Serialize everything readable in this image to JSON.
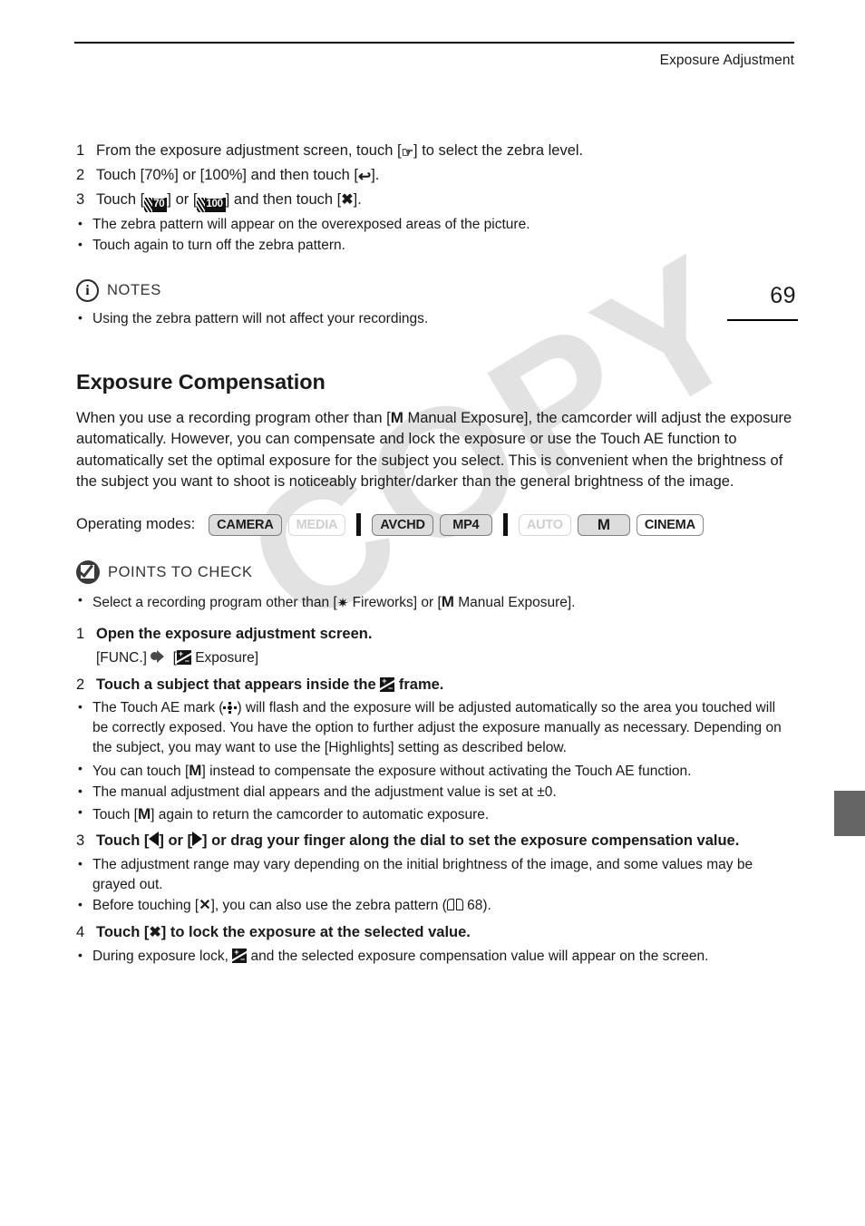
{
  "header": {
    "running_head": "Exposure Adjustment",
    "page_number": "69"
  },
  "zebra_steps": {
    "step1": {
      "num": "1",
      "pre": "From the exposure adjustment screen, touch [",
      "post": "] to select the zebra level.",
      "icon": "zebra-level-icon"
    },
    "step2": {
      "num": "2",
      "pre": "Touch [70%] or [100%] and then touch [",
      "post": "].",
      "icon": "return-icon"
    },
    "step3": {
      "num": "3",
      "pre": "Touch [",
      "mid": "] or [",
      "post": "] and then touch [",
      "tail": "].",
      "zebra70": "70",
      "zebra100": "100"
    },
    "bullets": [
      "The zebra pattern will appear on the overexposed areas of the picture.",
      "Touch again to turn off the zebra pattern."
    ]
  },
  "notes": {
    "label": "NOTES",
    "icon": "info-icon",
    "bullets": [
      "Using the zebra pattern will not affect your recordings."
    ]
  },
  "section": {
    "title": "Exposure Compensation",
    "intro_a": "When you use a recording program other than [",
    "intro_m": "M",
    "intro_b": " Manual Exposure], the camcorder will adjust the exposure automatically. However, you can compensate and lock the exposure or use the Touch AE function to automatically set the optimal exposure for the subject you select. This is convenient when the brightness of the subject you want to shoot is noticeably brighter/darker than the general brightness of the image."
  },
  "operating_modes": {
    "label": "Operating modes:",
    "badges": [
      {
        "label": "CAMERA",
        "state": "active"
      },
      {
        "label": "MEDIA",
        "state": "disabled"
      },
      {
        "label": "AVCHD",
        "state": "active"
      },
      {
        "label": "MP4",
        "state": "active"
      },
      {
        "label": "AUTO",
        "state": "disabled"
      },
      {
        "label": "M",
        "state": "active"
      },
      {
        "label": "CINEMA",
        "state": "outline"
      }
    ]
  },
  "points_to_check": {
    "label": "POINTS TO CHECK",
    "icon": "check-circle-icon",
    "bullet_a": "Select a recording program other than [",
    "bullet_fireworks": " Fireworks] or [",
    "bullet_m": "M",
    "bullet_b": " Manual Exposure]."
  },
  "procedure": {
    "step1": {
      "num": "1",
      "text": "Open the exposure adjustment screen.",
      "path_a": "[FUNC.]",
      "path_b": "[",
      "path_c": " Exposure]"
    },
    "step2": {
      "num": "2",
      "text_a": "Touch a subject that appears inside the ",
      "text_b": " frame.",
      "bullets": [
        {
          "a": "The Touch AE mark (",
          "b": ") will flash and the exposure will be adjusted automatically so the area you touched will be correctly exposed. You have the option to further adjust the exposure manually as necessary. Depending on the subject, you may want to use the [Highlights] setting as described below.",
          "icon": "touch-ae-icon"
        },
        {
          "a": "You can touch [",
          "m": "M",
          "b": "] instead to compensate the exposure without activating the Touch AE function."
        },
        {
          "a": "The manual adjustment dial appears and the adjustment value is set at ±0."
        },
        {
          "a": "Touch [",
          "m": "M",
          "b": "] again to return the camcorder to automatic exposure."
        }
      ]
    },
    "step3": {
      "num": "3",
      "text_a": "Touch [",
      "text_b": "] or [",
      "text_c": "] or drag your finger along the dial to set the exposure compensation value.",
      "bullets": [
        {
          "a": "The adjustment range may vary depending on the initial brightness of the image, and some values may be grayed out."
        },
        {
          "a": "Before touching [",
          "x": "✕",
          "b": "], you can also use the zebra pattern (",
          "ref": "68",
          "c": ")."
        }
      ]
    },
    "step4": {
      "num": "4",
      "text_a": "Touch [",
      "text_b": "] to lock the exposure at the selected value.",
      "bullets": [
        {
          "a": "During exposure lock, ",
          "b": " and the selected exposure compensation value will appear on the screen."
        }
      ]
    }
  },
  "watermark": {
    "text": "COPY"
  }
}
